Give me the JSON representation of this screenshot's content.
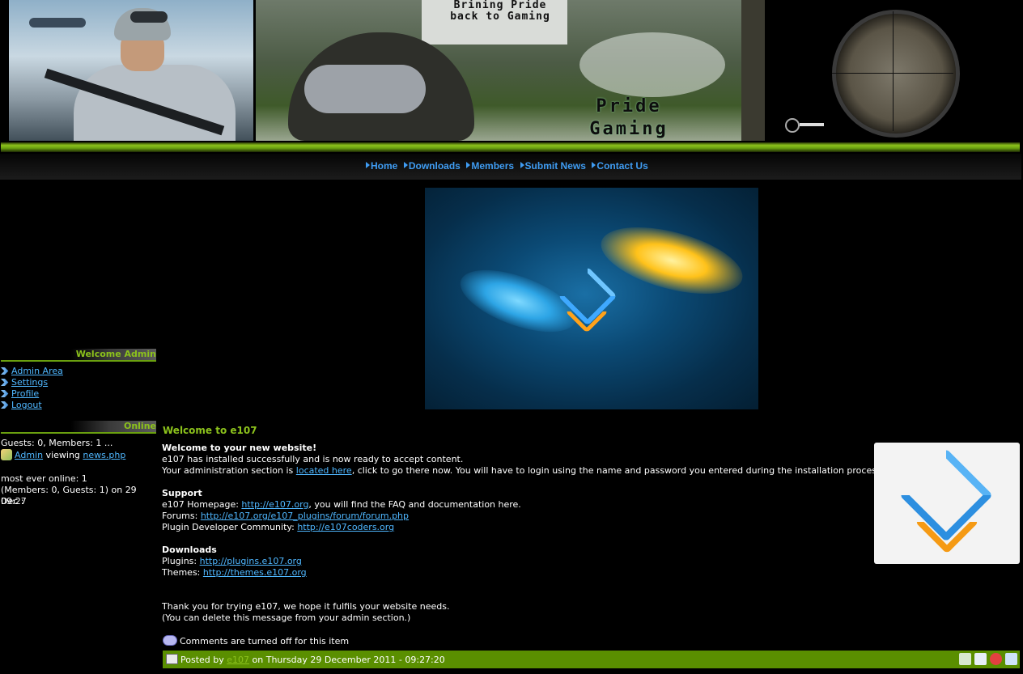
{
  "banner": {
    "tagline_line1": "Brining Pride",
    "tagline_line2": "back to Gaming",
    "title_line1": "Pride",
    "title_line2": "Gaming"
  },
  "nav": {
    "items": [
      {
        "label": "Home"
      },
      {
        "label": "Downloads"
      },
      {
        "label": "Members"
      },
      {
        "label": "Submit News"
      },
      {
        "label": "Contact Us"
      }
    ]
  },
  "sidebar": {
    "welcome_heading": "Welcome Admin",
    "links": [
      {
        "label": "Admin Area"
      },
      {
        "label": "Settings"
      },
      {
        "label": "Profile"
      },
      {
        "label": "Logout"
      }
    ],
    "online_heading": "Online",
    "online_summary": "Guests: 0, Members: 1 ...",
    "online_user": "Admin",
    "online_viewing": " viewing ",
    "online_page": "news.php",
    "most_ever_line1": "most ever online: 1",
    "most_ever_line2": "(Members: 0, Guests: 1) on 29 Dec :",
    "most_ever_line3": "09:27"
  },
  "news": {
    "title": "Welcome to e107",
    "heading": "Welcome to your new website!",
    "line1": "e107 has installed successfully and is now ready to accept content.",
    "line2_prefix": "Your administration section is ",
    "line2_link": "located here",
    "line2_suffix": ", click to go there now. You will have to login using the name and password you entered during the installation process.",
    "support_heading": "Support",
    "homepage_prefix": "e107 Homepage: ",
    "homepage_link": "http://e107.org",
    "homepage_suffix": ", you will find the FAQ and documentation here.",
    "forums_prefix": "Forums: ",
    "forums_link": "http://e107.org/e107_plugins/forum/forum.php",
    "plugin_dev_prefix": "Plugin Developer Community: ",
    "plugin_dev_link": "http://e107coders.org",
    "downloads_heading": "Downloads",
    "plugins_prefix": "Plugins: ",
    "plugins_link": "http://plugins.e107.org",
    "themes_prefix": "Themes: ",
    "themes_link": "http://themes.e107.org",
    "thanks_line1": "Thank you for trying e107, we hope it fulfils your website needs.",
    "thanks_line2": "(You can delete this message from your admin section.)",
    "comments_note": "Comments are turned off for this item"
  },
  "footer": {
    "posted_by_prefix": "Posted by ",
    "author": "e107",
    "posted_on": " on Thursday 29 December 2011 - 09:27:20"
  },
  "colors": {
    "accent_green": "#8cc21c",
    "link_blue": "#4fb7ff",
    "nav_blue": "#3f9cf2",
    "footer_green": "#5a8f00"
  }
}
